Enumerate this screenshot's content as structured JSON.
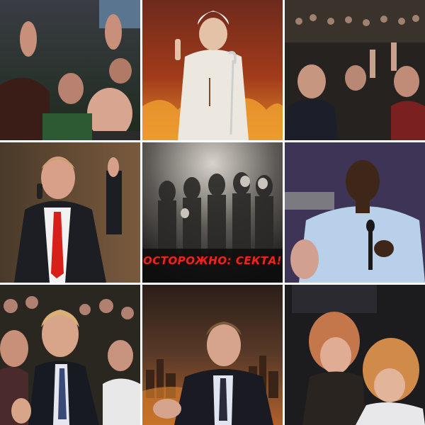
{
  "collage": {
    "cells": [
      {
        "subject": "crowd worshipping with raised hands"
      },
      {
        "subject": "child in white robe holding a staff before flames"
      },
      {
        "subject": "audience in auditorium with raised hands"
      },
      {
        "subject": "preacher in red tie singing into microphone"
      },
      {
        "subject": "dark crowd of shadowy figures"
      },
      {
        "subject": "preacher in light blue shirt holding microphone"
      },
      {
        "subject": "man with eyes closed among crowd"
      },
      {
        "subject": "man in suit before burning city"
      },
      {
        "subject": "women crying with hands over faces"
      }
    ],
    "warning_text": "ОСТОРОЖНО: СЕКТА!",
    "colors": {
      "warning_red": "#e8261b",
      "background": "#ffffff"
    }
  }
}
